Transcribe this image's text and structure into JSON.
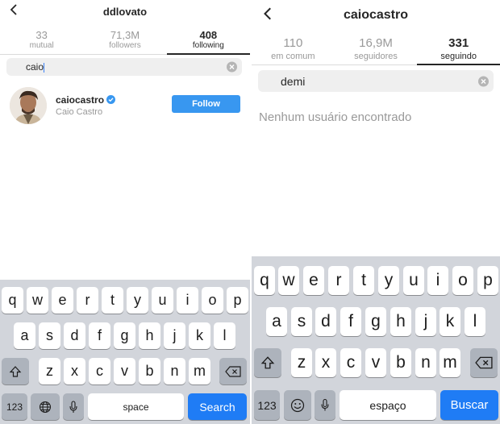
{
  "left": {
    "title": "ddlovato",
    "stats": [
      {
        "value": "33",
        "label": "mutual"
      },
      {
        "value": "71,3M",
        "label": "followers"
      },
      {
        "value": "408",
        "label": "following"
      }
    ],
    "search_value": "caio",
    "result": {
      "username": "caiocastro",
      "fullname": "Caio Castro",
      "button_label": "Follow"
    },
    "keyboard": {
      "row1": [
        "q",
        "w",
        "e",
        "r",
        "t",
        "y",
        "u",
        "i",
        "o",
        "p"
      ],
      "row2": [
        "a",
        "s",
        "d",
        "f",
        "g",
        "h",
        "j",
        "k",
        "l"
      ],
      "row3": [
        "z",
        "x",
        "c",
        "v",
        "b",
        "n",
        "m"
      ],
      "numbers_label": "123",
      "space_label": "space",
      "action_label": "Search"
    }
  },
  "right": {
    "title": "caiocastro",
    "stats": [
      {
        "value": "110",
        "label": "em comum"
      },
      {
        "value": "16,9M",
        "label": "seguidores"
      },
      {
        "value": "331",
        "label": "seguindo"
      }
    ],
    "search_value": "demi",
    "empty_message": "Nenhum usuário encontrado",
    "keyboard": {
      "row1": [
        "q",
        "w",
        "e",
        "r",
        "t",
        "y",
        "u",
        "i",
        "o",
        "p"
      ],
      "row2": [
        "a",
        "s",
        "d",
        "f",
        "g",
        "h",
        "j",
        "k",
        "l"
      ],
      "row3": [
        "z",
        "x",
        "c",
        "v",
        "b",
        "n",
        "m"
      ],
      "numbers_label": "123",
      "space_label": "espaço",
      "action_label": "Buscar"
    }
  },
  "colors": {
    "accent": "#3897f0",
    "keyboard_bg": "#d2d5db",
    "search_key": "#1f7cf5"
  }
}
